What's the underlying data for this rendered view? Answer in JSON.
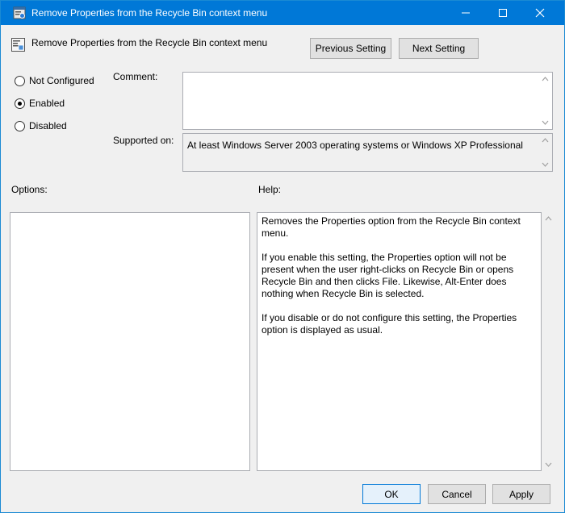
{
  "window": {
    "title": "Remove Properties from the Recycle Bin context menu",
    "icons": {
      "app": "policy-window-icon",
      "minimize": "minimize-icon",
      "maximize": "maximize-icon",
      "close": "close-icon"
    }
  },
  "header": {
    "title": "Remove Properties from the Recycle Bin context menu",
    "icon": "policy-setting-icon",
    "previous_label": "Previous Setting",
    "next_label": "Next Setting"
  },
  "state": {
    "options": [
      {
        "label": "Not Configured",
        "selected": false
      },
      {
        "label": "Enabled",
        "selected": true
      },
      {
        "label": "Disabled",
        "selected": false
      }
    ]
  },
  "comment": {
    "label": "Comment:",
    "value": ""
  },
  "supported": {
    "label": "Supported on:",
    "value": "At least Windows Server 2003 operating systems or Windows XP Professional"
  },
  "options_panel": {
    "label": "Options:"
  },
  "help_panel": {
    "label": "Help:",
    "paragraphs": [
      "Removes the Properties option from the Recycle Bin context menu.",
      "If you enable this setting, the Properties option will not be present when the user right-clicks on Recycle Bin or opens Recycle Bin and then clicks File. Likewise, Alt-Enter does nothing when Recycle Bin is selected.",
      "If you disable or do not configure this setting, the Properties option is displayed as usual."
    ]
  },
  "footer": {
    "ok_label": "OK",
    "cancel_label": "Cancel",
    "apply_label": "Apply"
  },
  "colors": {
    "titlebar": "#0078d7",
    "dialog_background": "#f0f0f0",
    "field_border": "#abadb3"
  }
}
